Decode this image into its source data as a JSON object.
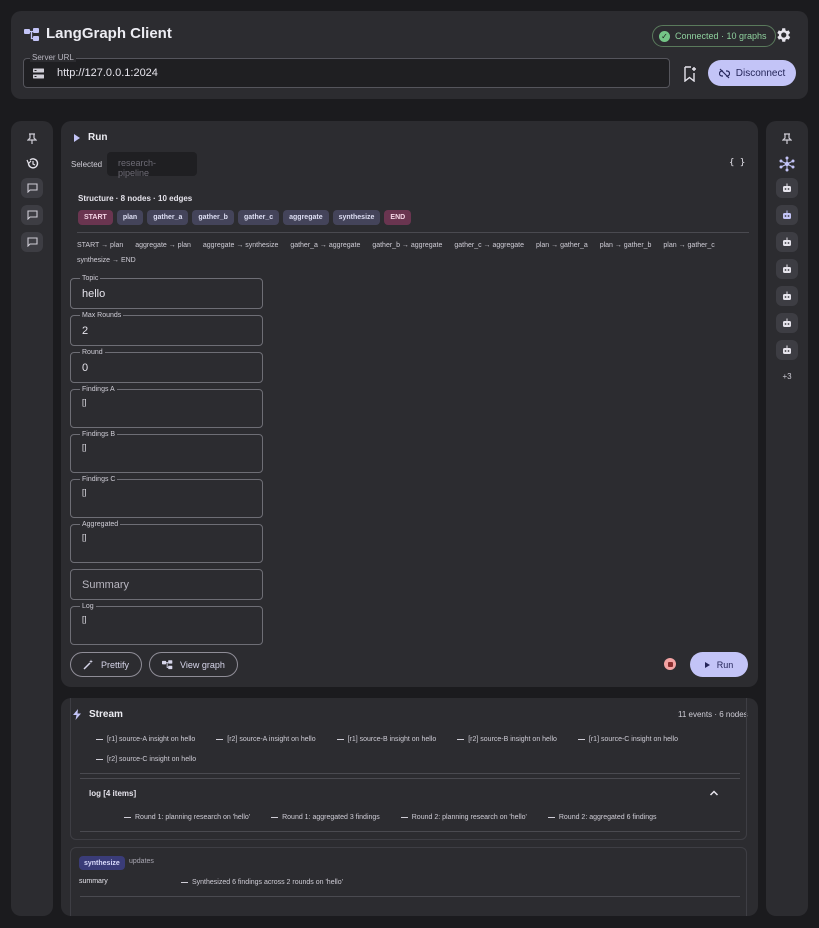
{
  "app": {
    "title": "LangGraph Client",
    "connection_status": "Connected · 10 graphs",
    "server_url_label": "Server URL",
    "server_url": "http://127.0.0.1:2024",
    "disconnect_label": "Disconnect"
  },
  "left_rail": {
    "icons": [
      "pin-icon",
      "history-icon",
      "chat-icon",
      "chat-icon",
      "chat-icon"
    ]
  },
  "right_rail": {
    "icons": [
      "pin-icon",
      "graph-icon",
      "robot-icon",
      "robot-icon",
      "robot-icon",
      "robot-icon",
      "robot-icon",
      "robot-icon",
      "robot-icon"
    ],
    "more_label": "+3"
  },
  "run": {
    "title": "Run",
    "selected_label": "Selected",
    "selected_value": "research-pipeline",
    "braces_label": "{ }",
    "structure_title": "Structure · 8 nodes · 10 edges",
    "nodes": [
      "START",
      "plan",
      "gather_a",
      "gather_b",
      "gather_c",
      "aggregate",
      "synthesize",
      "END"
    ],
    "edges": [
      "START → plan",
      "aggregate → plan",
      "aggregate → synthesize",
      "gather_a → aggregate",
      "gather_b → aggregate",
      "gather_c → aggregate",
      "plan → gather_a",
      "plan → gather_b",
      "plan → gather_c",
      "synthesize → END"
    ],
    "fields": {
      "topic": {
        "label": "Topic",
        "value": "hello"
      },
      "max_rounds": {
        "label": "Max Rounds",
        "value": "2"
      },
      "round": {
        "label": "Round",
        "value": "0"
      },
      "findings_a": {
        "label": "Findings A",
        "value": "[]"
      },
      "findings_b": {
        "label": "Findings B",
        "value": "[]"
      },
      "findings_c": {
        "label": "Findings C",
        "value": "[]"
      },
      "aggregated": {
        "label": "Aggregated",
        "value": "[]"
      },
      "summary": {
        "placeholder": "Summary"
      },
      "log": {
        "label": "Log",
        "value": "[]"
      }
    },
    "prettify_label": "Prettify",
    "view_graph_label": "View graph",
    "run_label": "Run"
  },
  "stream": {
    "title": "Stream",
    "count": "11 events · 6 nodes",
    "findings_items": [
      "[r1] source-A insight on hello",
      "[r2] source-A insight on hello",
      "[r1] source-B insight on hello",
      "[r2] source-B insight on hello",
      "[r1] source-C insight on hello",
      "[r2] source-C insight on hello"
    ],
    "log_header": "log   [4 items]",
    "log_items": [
      "Round 1: planning research on 'hello'",
      "Round 1: aggregated 3 findings",
      "Round 2: planning research on 'hello'",
      "Round 2: aggregated 6 findings"
    ],
    "node_tag": "synthesize",
    "node_updates": "updates",
    "summary_key": "summary",
    "summary_value": "Synthesized 6 findings across 2 rounds on 'hello'"
  }
}
